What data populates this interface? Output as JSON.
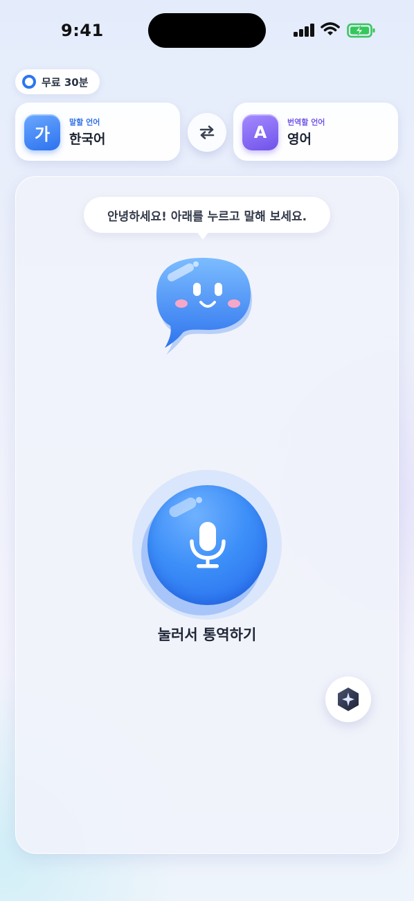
{
  "status_bar": {
    "time": "9:41",
    "icons": [
      "cellular-signal-icon",
      "wifi-icon",
      "battery-charging-icon"
    ],
    "battery_color": "#34c759"
  },
  "free_badge": {
    "label": "무료 30분",
    "accent": "#2a76f0"
  },
  "source_language": {
    "icon_glyph": "가",
    "caption": "말할 언어",
    "name": "한국어",
    "accent": "#2d6fe8"
  },
  "swap_button": {
    "icon": "swap-arrows-icon"
  },
  "target_language": {
    "icon_glyph": "A",
    "caption": "번역할 언어",
    "name": "영어",
    "accent": "#7256e6"
  },
  "greeting": {
    "text": "안녕하세요! 아래를 누르고 말해 보세요."
  },
  "mascot": {
    "icon": "chat-bubble-mascot-icon"
  },
  "mic": {
    "icon": "microphone-icon",
    "label": "눌러서 통역하기",
    "color": "#2f7ff3"
  },
  "ai_button": {
    "icon": "sparkle-hexagon-icon"
  }
}
